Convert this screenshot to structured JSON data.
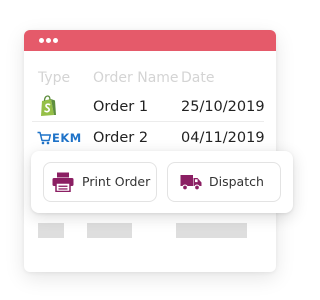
{
  "colors": {
    "accent": "#e55a6a",
    "button_icon": "#8b1f63",
    "shopify_green": "#95bf47",
    "ekm_blue": "#1f73c8"
  },
  "table": {
    "headers": [
      "Type",
      "Order Name",
      "Date"
    ],
    "rows": [
      {
        "type_icon": "shopify-icon",
        "name": "Order 1",
        "date": "25/10/2019"
      },
      {
        "type_icon": "ekm-logo",
        "name": "Order 2",
        "date": "04/11/2019"
      }
    ]
  },
  "ekm_logo_text": "EKM",
  "actions": {
    "print_label": "Print Order",
    "print_icon": "printer-icon",
    "dispatch_label": "Dispatch",
    "dispatch_icon": "truck-icon"
  }
}
